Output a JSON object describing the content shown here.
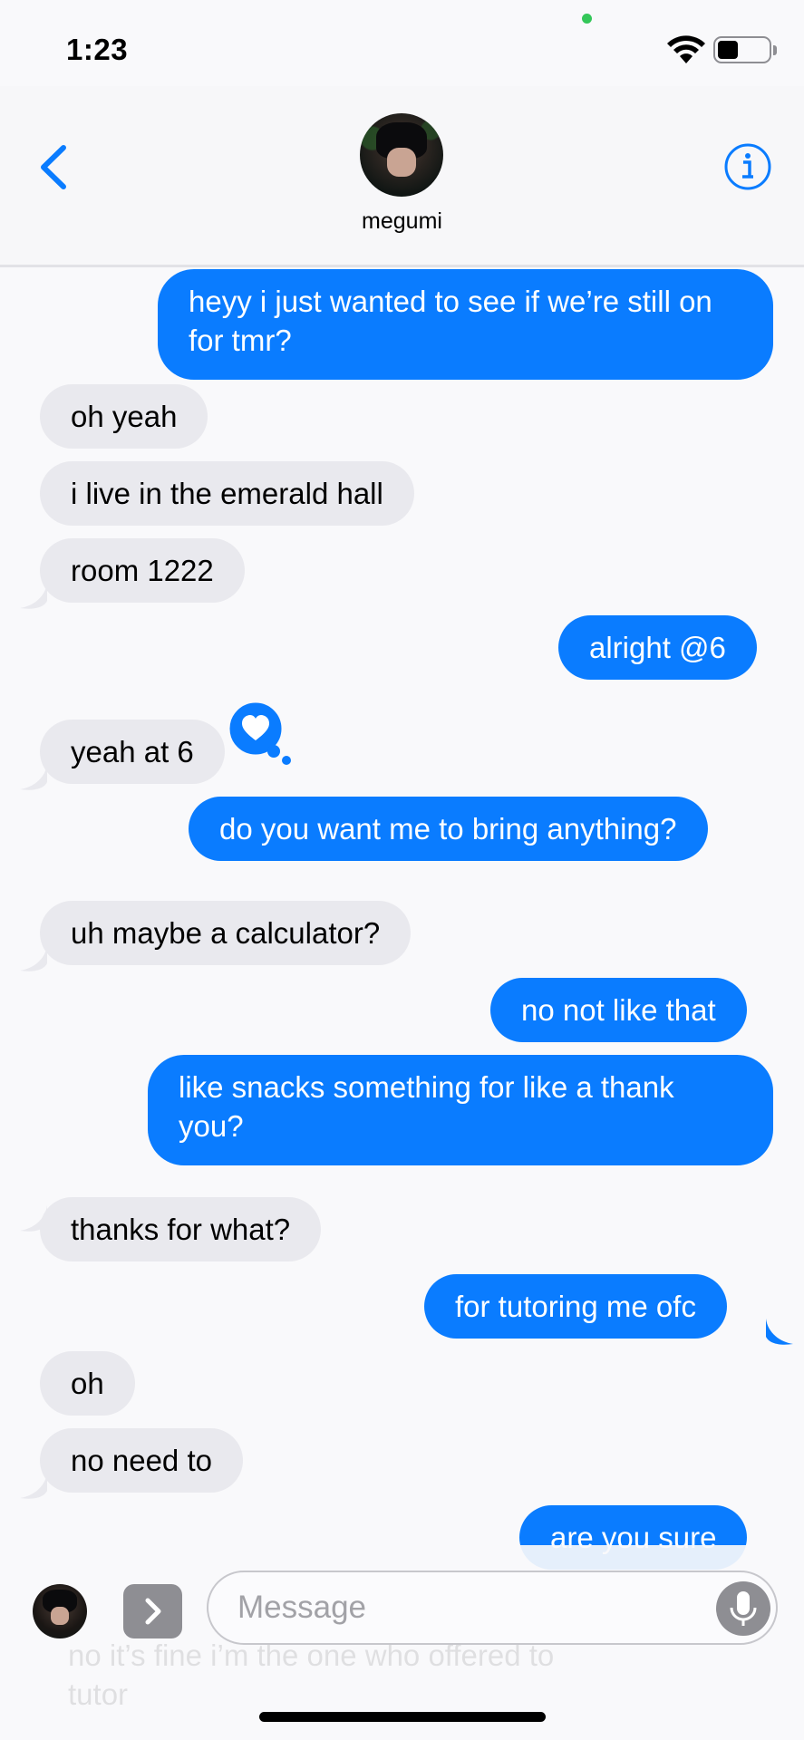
{
  "status_bar": {
    "time": "1:23"
  },
  "header": {
    "contact_name": "megumi",
    "back_icon": "chevron-left-icon",
    "info_icon": "info-circle-icon"
  },
  "colors": {
    "sent_bubble": "#0a7cff",
    "received_bubble": "#e9e9ee",
    "accent": "#0a7cff"
  },
  "messages": [
    {
      "dir": "sent",
      "text": "heyy i just wanted to see if we’re still on for tmr?"
    },
    {
      "dir": "received",
      "text": "oh yeah"
    },
    {
      "dir": "received",
      "text": "i live in the emerald hall"
    },
    {
      "dir": "received",
      "text": "room 1222"
    },
    {
      "dir": "sent",
      "text": "alright @6"
    },
    {
      "dir": "received",
      "text": "yeah at 6",
      "tapback": "heart-icon"
    },
    {
      "dir": "sent",
      "text": "do you want me to bring anything?"
    },
    {
      "dir": "received",
      "text": "uh maybe a calculator?"
    },
    {
      "dir": "sent",
      "text": "no not like that"
    },
    {
      "dir": "sent",
      "text": "like snacks something for like a thank you?"
    },
    {
      "dir": "received",
      "text": "thanks for what?"
    },
    {
      "dir": "sent",
      "text": "for tutoring me ofc"
    },
    {
      "dir": "received",
      "text": "oh"
    },
    {
      "dir": "received",
      "text": "no need to"
    },
    {
      "dir": "sent",
      "text": "are you sure"
    },
    {
      "dir": "received",
      "text": "no it’s fine i’m the one who offered to tutor"
    }
  ],
  "input": {
    "placeholder": "Message",
    "apps_icon": "chevron-right-icon",
    "mic_icon": "microphone-icon"
  }
}
